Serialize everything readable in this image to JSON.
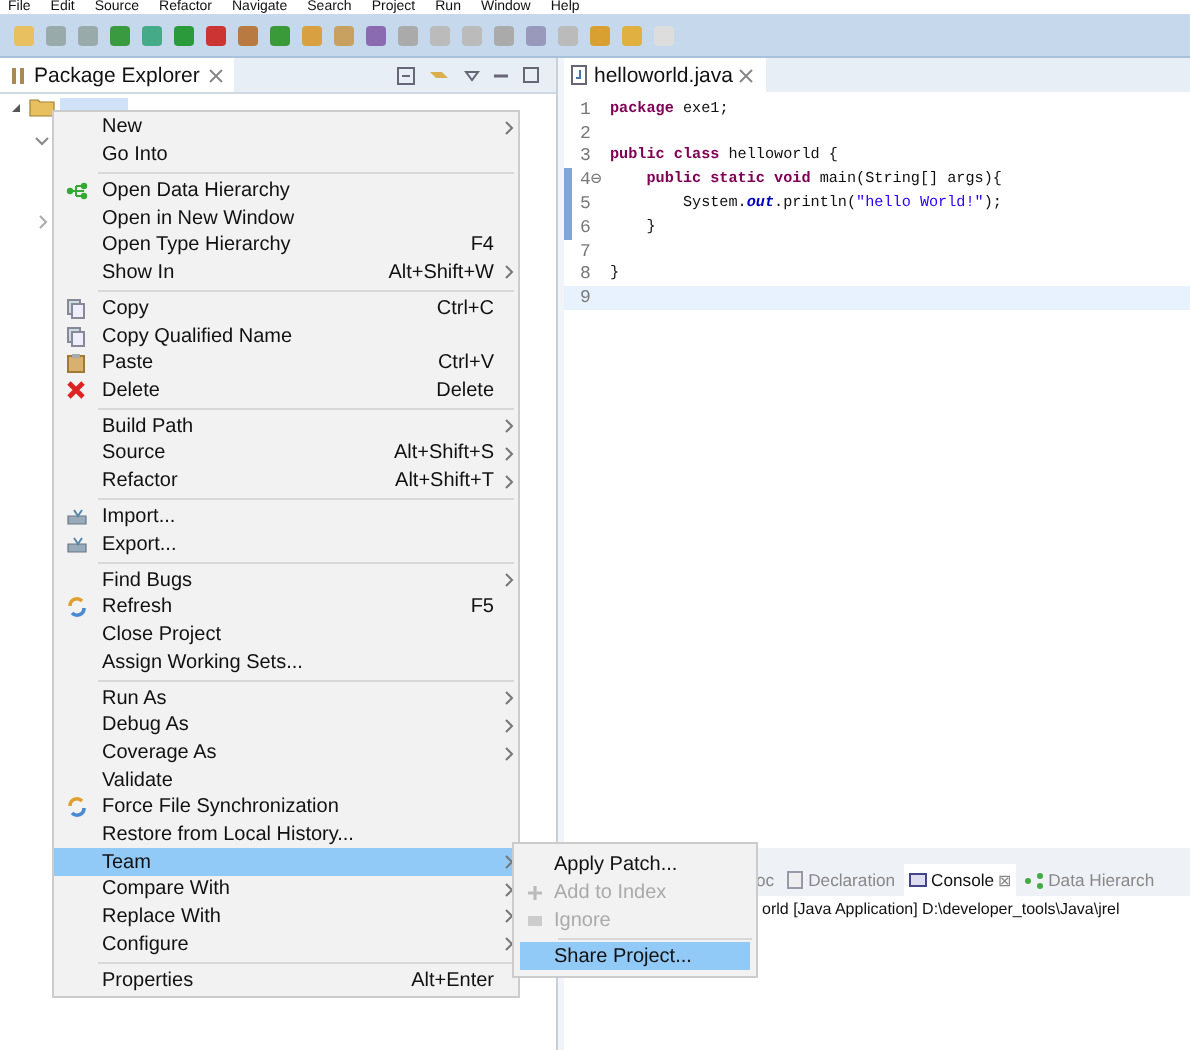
{
  "menu_bar": [
    "File",
    "Edit",
    "Source",
    "Refactor",
    "Navigate",
    "Search",
    "Project",
    "Run",
    "Window",
    "Help"
  ],
  "package_explorer": {
    "title": "Package Explorer",
    "tree_row": {
      "selected": true,
      "expanded": true
    }
  },
  "editor": {
    "tab": "helloworld.java",
    "lines": [
      {
        "n": "1",
        "tokens": [
          {
            "kind": "keyword",
            "t": "package"
          },
          {
            "kind": "plain",
            "t": " exe1;"
          }
        ]
      },
      {
        "n": "2"
      },
      {
        "n": "3",
        "tokens": [
          {
            "kind": "keyword",
            "t": "public class"
          },
          {
            "kind": "plain",
            "t": " helloworld {"
          }
        ]
      },
      {
        "n": "4⊖",
        "tokens": [
          {
            "kind": "keyword",
            "t": "    public static void"
          },
          {
            "kind": "plain",
            "t": " main(String[] args){"
          }
        ]
      },
      {
        "n": "5",
        "tokens": [
          {
            "kind": "plain",
            "t": "        System."
          },
          {
            "kind": "field",
            "t": "out"
          },
          {
            "kind": "plain",
            "t": ".println("
          },
          {
            "kind": "string",
            "t": "\"hello World!\""
          },
          {
            "kind": "plain",
            "t": ");"
          }
        ]
      },
      {
        "n": "6",
        "tokens": [
          {
            "kind": "plain",
            "t": "    }"
          }
        ]
      },
      {
        "n": "7"
      },
      {
        "n": "8",
        "tokens": [
          {
            "kind": "plain",
            "t": "}"
          }
        ]
      },
      {
        "n": "9",
        "current": true
      }
    ]
  },
  "context_menu": [
    {
      "kind": "item",
      "label": "New",
      "submenu": true,
      "selected": false
    },
    {
      "kind": "item",
      "label": "Go Into",
      "selected": false
    },
    {
      "kind": "separator"
    },
    {
      "kind": "item",
      "label": "Open Data Hierarchy",
      "selected": false
    },
    {
      "kind": "item",
      "label": "Open in New Window",
      "selected": false
    },
    {
      "kind": "item",
      "label": "Open Type Hierarchy",
      "shortcut": "F4",
      "selected": false
    },
    {
      "kind": "item",
      "label": "Show In",
      "shortcut": "Alt+Shift+W",
      "submenu": true,
      "selected": false
    },
    {
      "kind": "separator"
    },
    {
      "kind": "item",
      "label": "Copy",
      "shortcut": "Ctrl+C",
      "selected": false
    },
    {
      "kind": "item",
      "label": "Copy Qualified Name",
      "selected": false
    },
    {
      "kind": "item",
      "label": "Paste",
      "shortcut": "Ctrl+V",
      "selected": false
    },
    {
      "kind": "item",
      "label": "Delete",
      "shortcut": "Delete",
      "selected": false
    },
    {
      "kind": "separator"
    },
    {
      "kind": "item",
      "label": "Build Path",
      "submenu": true,
      "selected": false
    },
    {
      "kind": "item",
      "label": "Source",
      "shortcut": "Alt+Shift+S",
      "submenu": true,
      "selected": false
    },
    {
      "kind": "item",
      "label": "Refactor",
      "shortcut": "Alt+Shift+T",
      "submenu": true,
      "selected": false
    },
    {
      "kind": "separator"
    },
    {
      "kind": "item",
      "label": "Import...",
      "selected": false
    },
    {
      "kind": "item",
      "label": "Export...",
      "selected": false
    },
    {
      "kind": "separator"
    },
    {
      "kind": "item",
      "label": "Find Bugs",
      "submenu": true,
      "selected": false
    },
    {
      "kind": "item",
      "label": "Refresh",
      "shortcut": "F5",
      "selected": false
    },
    {
      "kind": "item",
      "label": "Close Project",
      "selected": false
    },
    {
      "kind": "item",
      "label": "Assign Working Sets...",
      "selected": false
    },
    {
      "kind": "separator"
    },
    {
      "kind": "item",
      "label": "Run As",
      "submenu": true,
      "selected": false
    },
    {
      "kind": "item",
      "label": "Debug As",
      "submenu": true,
      "selected": false
    },
    {
      "kind": "item",
      "label": "Coverage As",
      "submenu": true,
      "selected": false
    },
    {
      "kind": "item",
      "label": "Validate",
      "selected": false
    },
    {
      "kind": "item",
      "label": "Force File Synchronization",
      "selected": false
    },
    {
      "kind": "item",
      "label": "Restore from Local History...",
      "selected": false
    },
    {
      "kind": "item",
      "label": "Team",
      "submenu": true,
      "selected": true
    },
    {
      "kind": "item",
      "label": "Compare With",
      "submenu": true,
      "selected": false
    },
    {
      "kind": "item",
      "label": "Replace With",
      "submenu": true,
      "selected": false
    },
    {
      "kind": "item",
      "label": "Configure",
      "submenu": true,
      "selected": false
    },
    {
      "kind": "separator"
    },
    {
      "kind": "item",
      "label": "Properties",
      "shortcut": "Alt+Enter",
      "selected": false
    }
  ],
  "team_submenu": [
    {
      "kind": "item",
      "label": "Apply Patch...",
      "disabled": false,
      "selected": false
    },
    {
      "kind": "item",
      "label": "Add to Index",
      "disabled": true,
      "selected": false
    },
    {
      "kind": "item",
      "label": "Ignore",
      "disabled": true,
      "selected": false
    },
    {
      "kind": "separator"
    },
    {
      "kind": "item",
      "label": "Share Project...",
      "disabled": false,
      "selected": true
    }
  ],
  "bottom_panel": {
    "tabs": [
      {
        "label": "oc",
        "selected": false
      },
      {
        "label": "Declaration",
        "selected": false
      },
      {
        "label": "Console",
        "selected": true,
        "close": "⊠"
      },
      {
        "label": "Data Hierarch",
        "selected": false
      }
    ],
    "console_line": "orld [Java Application] D:\\developer_tools\\Java\\jrel"
  }
}
